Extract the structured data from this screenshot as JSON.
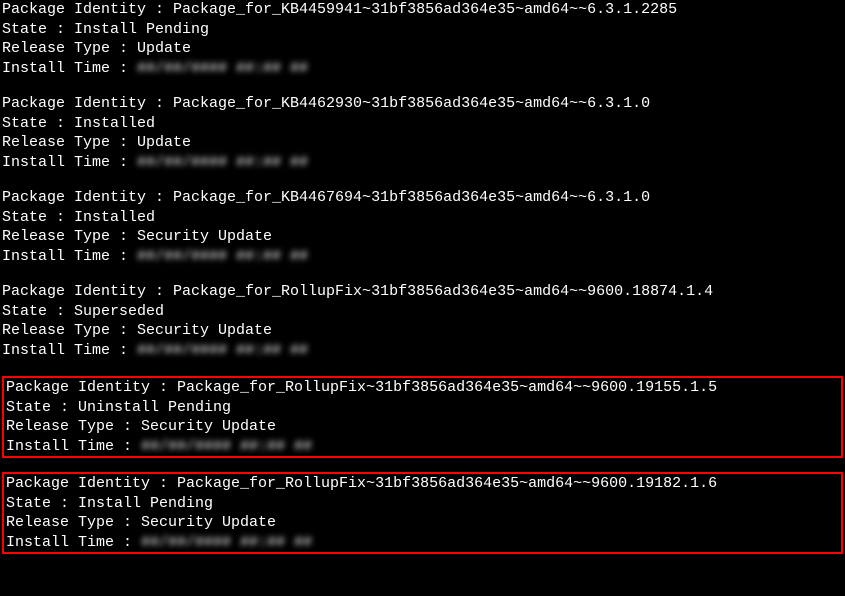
{
  "labels": {
    "package_identity": "Package Identity : ",
    "state": "State : ",
    "release_type": "Release Type : ",
    "install_time": "Install Time : "
  },
  "packages": [
    {
      "identity": "Package_for_KB4459941~31bf3856ad364e35~amd64~~6.3.1.2285",
      "state": "Install Pending",
      "release_type": "Update",
      "install_time_redacted": "##/##/#### ##:## ##",
      "highlighted": false
    },
    {
      "identity": "Package_for_KB4462930~31bf3856ad364e35~amd64~~6.3.1.0",
      "state": "Installed",
      "release_type": "Update",
      "install_time_redacted": "##/##/#### ##:## ##",
      "highlighted": false
    },
    {
      "identity": "Package_for_KB4467694~31bf3856ad364e35~amd64~~6.3.1.0",
      "state": "Installed",
      "release_type": "Security Update",
      "install_time_redacted": "##/##/#### ##:## ##",
      "highlighted": false
    },
    {
      "identity": "Package_for_RollupFix~31bf3856ad364e35~amd64~~9600.18874.1.4",
      "state": "Superseded",
      "release_type": "Security Update",
      "install_time_redacted": "##/##/#### ##:## ##",
      "highlighted": false
    },
    {
      "identity": "Package_for_RollupFix~31bf3856ad364e35~amd64~~9600.19155.1.5",
      "state": "Uninstall Pending",
      "release_type": "Security Update",
      "install_time_redacted": "##/##/#### ##:## ##",
      "highlighted": true
    },
    {
      "identity": "Package_for_RollupFix~31bf3856ad364e35~amd64~~9600.19182.1.6",
      "state": "Install Pending",
      "release_type": "Security Update",
      "install_time_redacted": "##/##/#### ##:## ##",
      "highlighted": true
    }
  ]
}
